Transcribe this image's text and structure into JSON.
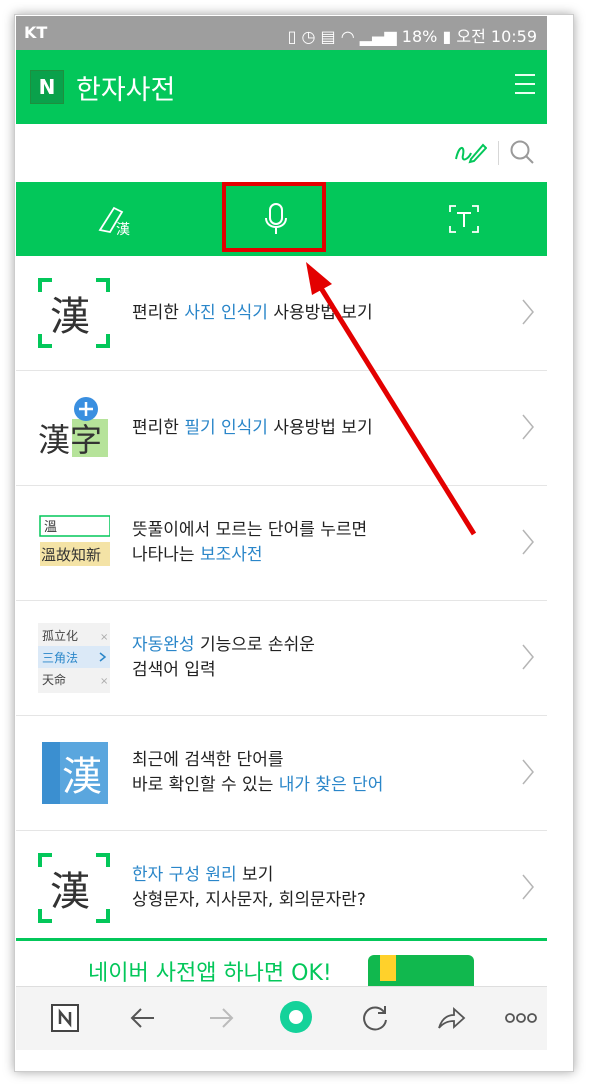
{
  "status": {
    "carrier": "KT",
    "battery": "18%",
    "time": "오전 10:59"
  },
  "header": {
    "logo": "N",
    "title": "한자사전"
  },
  "items": [
    {
      "thumb": "漢",
      "pre": "편리한 ",
      "hl": "사진 인식기",
      "post": " 사용방법 보기"
    },
    {
      "thumb": "漢字",
      "pre": "편리한 ",
      "hl": "필기 인식기",
      "post": " 사용방법 보기"
    },
    {
      "thumb_top": "溫",
      "thumb_bottom": "溫故知新",
      "line1": "뜻풀이에서 모르는 단어를 누르면",
      "line2_pre": "나타나는 ",
      "line2_hl": "보조사전"
    },
    {
      "thumb_rows": [
        "孤立化",
        "三角法",
        "天命"
      ],
      "hl": "자동완성",
      "post": " 기능으로 손쉬운",
      "line2": "검색어 입력"
    },
    {
      "thumb": "漢",
      "line1": "최근에 검색한 단어를",
      "line2_pre": "바로 확인할 수 있는 ",
      "line2_hl": "내가 찾은 단어"
    },
    {
      "thumb": "漢",
      "hl": "한자 구성 원리",
      "post": " 보기",
      "line2": "상형문자, 지사문자, 회의문자란?"
    }
  ],
  "promo": {
    "text": "네이버 사전앱 하나면 OK!"
  },
  "colors": {
    "brand": "#03c75a",
    "highlight": "#2a86c9",
    "annotation": "#e30000"
  }
}
